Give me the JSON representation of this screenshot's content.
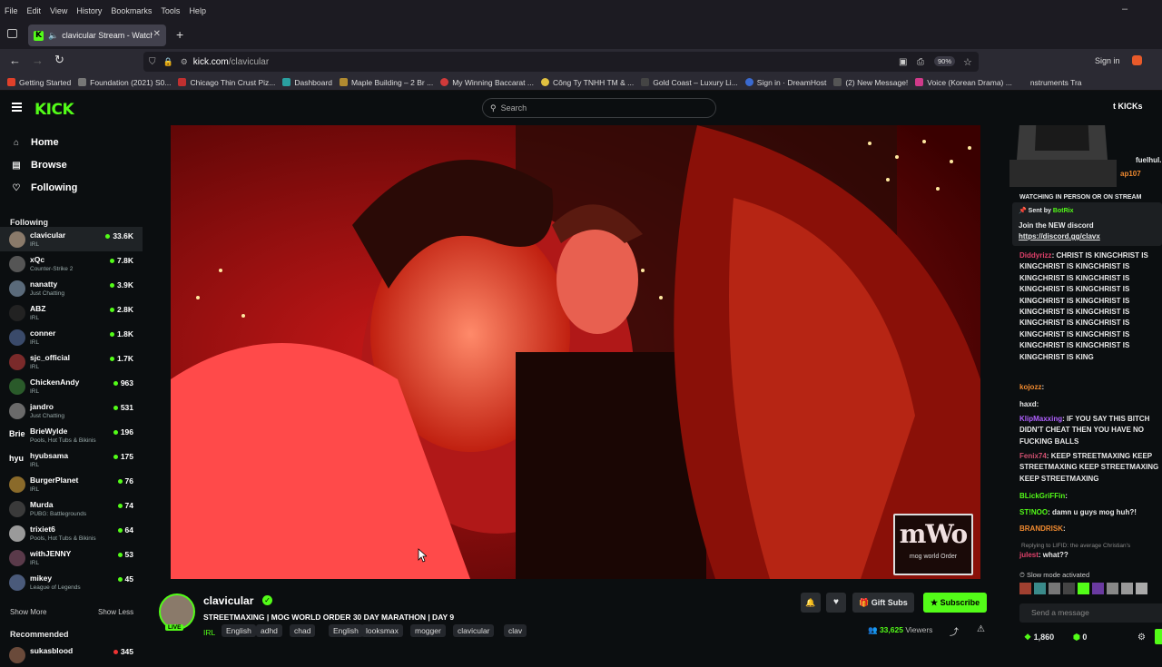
{
  "browser": {
    "menu": [
      "File",
      "Edit",
      "View",
      "History",
      "Bookmarks",
      "Tools",
      "Help"
    ],
    "tab_title": "clavicular Stream - Watch L",
    "url_host": "kick.com",
    "url_path": "/clavicular",
    "zoom": "90%",
    "sign_in": "Sign in",
    "bookmarks": [
      "Getting Started",
      "Foundation (2021) S0...",
      "Chicago Thin Crust Piz...",
      "Dashboard",
      "Maple Building – 2 Br ...",
      "My Winning Baccarat ...",
      "Công Ty TNHH TM & ...",
      "Gold Coast – Luxury Li...",
      "Sign in · DreamHost",
      "(2) New Message!",
      "Voice (Korean Drama) ...",
      "nstruments Tra"
    ]
  },
  "kick": {
    "logo": "KICK",
    "search_placeholder": "Search",
    "header_right": "t KICKs"
  },
  "sidebar": {
    "nav": [
      {
        "label": "Home",
        "icon": "home-icon"
      },
      {
        "label": "Browse",
        "icon": "browse-icon"
      },
      {
        "label": "Following",
        "icon": "heart-icon"
      }
    ],
    "following_title": "Following",
    "following": [
      {
        "name": "clavicular",
        "category": "IRL",
        "viewers": "33.6K",
        "color": "#8a7a6a"
      },
      {
        "name": "xQc",
        "category": "Counter-Strike 2",
        "viewers": "7.8K",
        "color": "#555555"
      },
      {
        "name": "nanatty",
        "category": "Just Chatting",
        "viewers": "3.9K",
        "color": "#5a6a7a"
      },
      {
        "name": "ABZ",
        "category": "IRL",
        "viewers": "2.8K",
        "color": "#222222"
      },
      {
        "name": "conner",
        "category": "IRL",
        "viewers": "1.8K",
        "color": "#3a4a6a"
      },
      {
        "name": "sjc_official",
        "category": "IRL",
        "viewers": "1.7K",
        "color": "#7a2a2a"
      },
      {
        "name": "ChickenAndy",
        "category": "IRL",
        "viewers": "963",
        "color": "#2a5a2a"
      },
      {
        "name": "jandro",
        "category": "Just Chatting",
        "viewers": "531",
        "color": "#6a6a6a"
      },
      {
        "name": "BrieWylde",
        "category": "Pools, Hot Tubs & Bikinis",
        "viewers": "196",
        "color": "#0b0e10",
        "avatar_text": "Brie"
      },
      {
        "name": "hyubsama",
        "category": "IRL",
        "viewers": "175",
        "color": "#0b0e10",
        "avatar_text": "hyu"
      },
      {
        "name": "BurgerPlanet",
        "category": "IRL",
        "viewers": "76",
        "color": "#8a6a2a"
      },
      {
        "name": "Murda",
        "category": "PUBG: Battlegrounds",
        "viewers": "74",
        "color": "#3a3a3a"
      },
      {
        "name": "trixiet6",
        "category": "Pools, Hot Tubs & Bikinis",
        "viewers": "64",
        "color": "#9a9a9a"
      },
      {
        "name": "withJENNY",
        "category": "IRL",
        "viewers": "53",
        "color": "#5a3a4a"
      },
      {
        "name": "mikey",
        "category": "League of Legends",
        "viewers": "45",
        "color": "#4a5a7a"
      }
    ],
    "show_more": "Show More",
    "show_less": "Show Less",
    "recommended_title": "Recommended",
    "recommended": [
      {
        "name": "sukasblood",
        "viewers": "345"
      }
    ]
  },
  "stream": {
    "channel": "clavicular",
    "live_badge": "LIVE",
    "title": "STREETMAXING | MOG WORLD ORDER 30 DAY MARATHON | DAY 9",
    "category": "IRL",
    "tags": [
      "English",
      "adhd",
      "chad",
      "English",
      "looksmax",
      "mogger",
      "clavicular",
      "clav"
    ],
    "viewers": "33,625",
    "viewers_label": "Viewers",
    "gift_subs": "Gift Subs",
    "subscribe": "Subscribe",
    "watermark_big": "mWo",
    "watermark_small": "mog world Order",
    "colors": {
      "accent": "#53fc18"
    }
  },
  "chat": {
    "top_name1": "fuelhul...",
    "top_name2": "ap107",
    "banner_cut": "WATCHING IN PERSON OR ON STREAM",
    "sent_by_label": "Sent by",
    "sent_by_name": "BotRix",
    "pinned_text": "Join the NEW discord",
    "pinned_link": "https://discord.gg/clavx",
    "messages": [
      {
        "user": "Diddyrizz",
        "user_color": "#e0406a",
        "text": "CHRIST IS KINGCHRIST IS KINGCHRIST IS KINGCHRIST IS KINGCHRIST IS KINGCHRIST IS KINGCHRIST IS KINGCHRIST IS KINGCHRIST IS KINGCHRIST IS KINGCHRIST IS KINGCHRIST IS KINGCHRIST IS KINGCHRIST IS KINGCHRIST IS KINGCHRIST IS KINGCHRIST IS KINGCHRIST IS KINGCHRIST IS KING"
      },
      {
        "user": "kojozz",
        "user_color": "#f08a30",
        "text": ""
      },
      {
        "user": "haxd",
        "user_color": "#e8e8e8",
        "text": ""
      },
      {
        "user": "KlipMaxxing",
        "user_color": "#b060ff",
        "text": "IF YOU SAY THIS BITCH DIDN'T CHEAT THEN YOU HAVE NO FUCKING BALLS"
      },
      {
        "user": "Fenix74",
        "user_color": "#d05070",
        "text": "KEEP STREETMAXING KEEP STREETMAXING KEEP STREETMAXING KEEP STREETMAXING"
      },
      {
        "user": "BLickGriFFin",
        "user_color": "#53fc18",
        "text": ""
      },
      {
        "user": "ST!NOO",
        "user_color": "#53fc18",
        "text": "damn u guys mog huh?!"
      },
      {
        "user": "BRANDRISK",
        "user_color": "#f08a30",
        "text": ""
      },
      {
        "user": "julest",
        "user_color": "#e0406a",
        "text": "what??"
      }
    ],
    "reply_text": "Replying to LIFID: the average Christian's",
    "slow_mode": "Slow mode activated",
    "send_placeholder": "Send a message",
    "points": "1,860",
    "points2": "0"
  }
}
